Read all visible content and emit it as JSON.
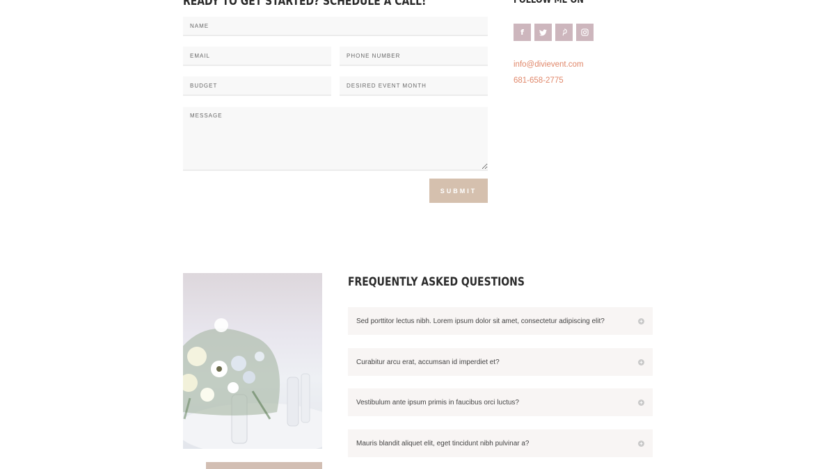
{
  "contact_form": {
    "title": "READY TO GET STARTED? SCHEDULE A CALL!",
    "name_placeholder": "NAME",
    "email_placeholder": "EMAIL",
    "phone_placeholder": "PHONE NUMBER",
    "budget_placeholder": "BUDGET",
    "month_placeholder": "DESIRED EVENT MONTH",
    "message_placeholder": "MESSAGE",
    "submit_label": "SUBMIT"
  },
  "follow": {
    "title": "FOLLOW ME ON",
    "icons": [
      {
        "name": "facebook-icon",
        "glyph": "f"
      },
      {
        "name": "twitter-icon",
        "glyph": "t"
      },
      {
        "name": "pinterest-icon",
        "glyph": "p"
      },
      {
        "name": "instagram-icon",
        "glyph": "◎"
      }
    ],
    "email": "info@divievent.com",
    "phone": "681-658-2775",
    "accent_color": "#e0876a",
    "icon_bg_color": "#cdb6bd"
  },
  "faq": {
    "title": "FREQUENTLY ASKED QUESTIONS",
    "items": [
      {
        "question": "Sed porttitor lectus nibh. Lorem ipsum dolor sit amet, consectetur adipiscing elit?"
      },
      {
        "question": "Curabitur arcu erat, accumsan id imperdiet et?"
      },
      {
        "question": "Vestibulum ante ipsum primis in faucibus orci luctus?"
      },
      {
        "question": "Mauris blandit aliquet elit, eget tincidunt nibh pulvinar a?"
      }
    ],
    "toggle_glyph": "+"
  },
  "colors": {
    "submit_bg": "#d5c0ae"
  }
}
